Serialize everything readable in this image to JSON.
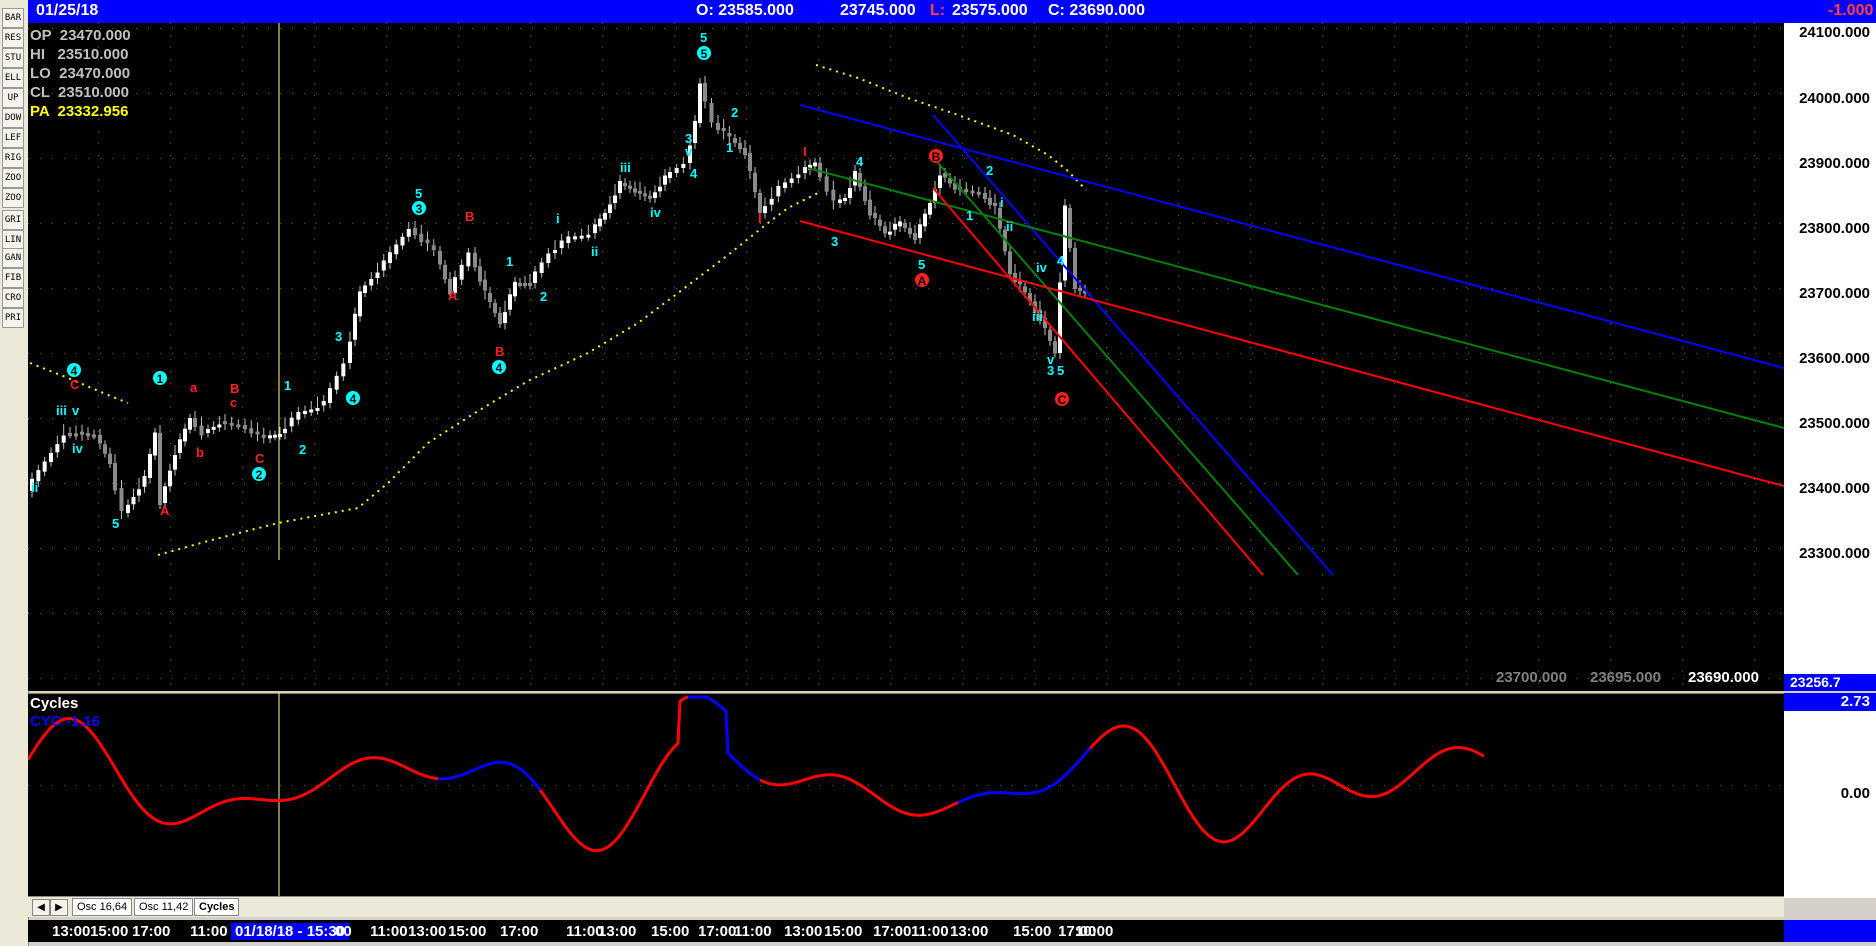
{
  "topbar": {
    "date": "01/25/18",
    "open": "O: 23585.000",
    "high": "23745.000",
    "low_label": "L:",
    "low": "23575.000",
    "close": "C: 23690.000",
    "change": "-1.000"
  },
  "ohlc": {
    "op": "OP  23470.000",
    "hi": "HI   23510.000",
    "lo": "LO  23470.000",
    "cl": "CL  23510.000",
    "pa": "PA  23332.956"
  },
  "price_axis": [
    "24100.000",
    "24000.000",
    "23900.000",
    "23800.000",
    "23700.000",
    "23600.000",
    "23500.000",
    "23400.000",
    "23300.000"
  ],
  "price_axis_bottom": "23256.7",
  "bottom_values": [
    "23700.000",
    "23695.000",
    "23690.000"
  ],
  "osc": {
    "title": "Cycles",
    "cyc": "CYC -1.16",
    "axis_top": "2.73",
    "axis_zero": "0.00"
  },
  "tabs": [
    "Osc 16,64",
    "Osc 11,42",
    "Cycles"
  ],
  "time_axis": [
    "13:00",
    "15:00",
    "17:00",
    "11:00",
    "01/18/18 - 15:30",
    "00",
    "11:00",
    "13:00",
    "15:00",
    "17:00",
    "11:00",
    "13:00",
    "15:00",
    "17:00",
    "11:00",
    "13:00",
    "15:00",
    "17:00",
    "11:00",
    "13:00",
    "15:00",
    "17:00",
    "10:00"
  ],
  "toolbar": [
    "BAR",
    "RESET",
    "STUDY",
    "ELLIOTT",
    "UP",
    "DOWN",
    "LEFT",
    "RIGHT",
    "ZOOM IN",
    "ZOOM OUT",
    "GRID",
    "LINES",
    "GANN",
    "FIB",
    "CROSS",
    "PRINT"
  ],
  "wave_labels": [
    {
      "t": "ii",
      "c": "#00ffff"
    },
    {
      "t": "iii",
      "c": "#00ffff"
    },
    {
      "t": "v",
      "c": "#00ffff"
    },
    {
      "t": "iv",
      "c": "#00ffff"
    },
    {
      "t": "4",
      "c": "#00ffff"
    },
    {
      "t": "C",
      "c": "#ff2020"
    },
    {
      "t": "5",
      "c": "#00ffff"
    },
    {
      "t": "1",
      "c": "#00ffff"
    },
    {
      "t": "A",
      "c": "#ff2020"
    },
    {
      "t": "a",
      "c": "#ff2020"
    },
    {
      "t": "b",
      "c": "#ff2020"
    },
    {
      "t": "B",
      "c": "#ff2020"
    },
    {
      "t": "c",
      "c": "#ff2020"
    },
    {
      "t": "C",
      "c": "#ff2020"
    },
    {
      "t": "2",
      "c": "#00ffff"
    },
    {
      "t": "1",
      "c": "#00ffff"
    },
    {
      "t": "2",
      "c": "#00ffff"
    },
    {
      "t": "3",
      "c": "#00ffff"
    },
    {
      "t": "4",
      "c": "#00ffff"
    },
    {
      "t": "3",
      "c": "#00ffff"
    },
    {
      "t": "5",
      "c": "#00ffff"
    },
    {
      "t": "B",
      "c": "#ff2020"
    },
    {
      "t": "A",
      "c": "#ff2020"
    },
    {
      "t": "B",
      "c": "#ff2020"
    },
    {
      "t": "4",
      "c": "#00ffff"
    },
    {
      "t": "1",
      "c": "#00ffff"
    },
    {
      "t": "2",
      "c": "#00ffff"
    },
    {
      "t": "i",
      "c": "#00ffff"
    },
    {
      "t": "ii",
      "c": "#00ffff"
    },
    {
      "t": "iii",
      "c": "#00ffff"
    },
    {
      "t": "iv",
      "c": "#00ffff"
    },
    {
      "t": "3",
      "c": "#00ffff"
    },
    {
      "t": "v",
      "c": "#00ffff"
    },
    {
      "t": "4",
      "c": "#00ffff"
    },
    {
      "t": "5",
      "c": "#00ffff"
    },
    {
      "t": "5",
      "c": "#00ffff"
    },
    {
      "t": "2",
      "c": "#00ffff"
    },
    {
      "t": "1",
      "c": "#00ffff"
    },
    {
      "t": "I",
      "c": "#ff2020"
    },
    {
      "t": "I",
      "c": "#ff2020"
    },
    {
      "t": "4",
      "c": "#00ffff"
    },
    {
      "t": "3",
      "c": "#00ffff"
    },
    {
      "t": "5",
      "c": "#00ffff"
    },
    {
      "t": "A",
      "c": "#ff2020"
    },
    {
      "t": "B",
      "c": "#ff2020"
    },
    {
      "t": "2",
      "c": "#00ffff"
    },
    {
      "t": "1",
      "c": "#00ffff"
    },
    {
      "t": "i",
      "c": "#00ffff"
    },
    {
      "t": "ii",
      "c": "#00ffff"
    },
    {
      "t": "iv",
      "c": "#00ffff"
    },
    {
      "t": "4",
      "c": "#00ffff"
    },
    {
      "t": "iii",
      "c": "#00ffff"
    },
    {
      "t": "v",
      "c": "#00ffff"
    },
    {
      "t": "3",
      "c": "#00ffff"
    },
    {
      "t": "5",
      "c": "#00ffff"
    },
    {
      "t": "C",
      "c": "#ff2020"
    }
  ],
  "colors": {
    "up": "#00ffff",
    "down": "#ff2020",
    "blue_channel": "#0000ff",
    "green_channel": "#008000",
    "red_channel": "#ff0000",
    "ma": "#ffff00",
    "header": "#0000ff"
  }
}
